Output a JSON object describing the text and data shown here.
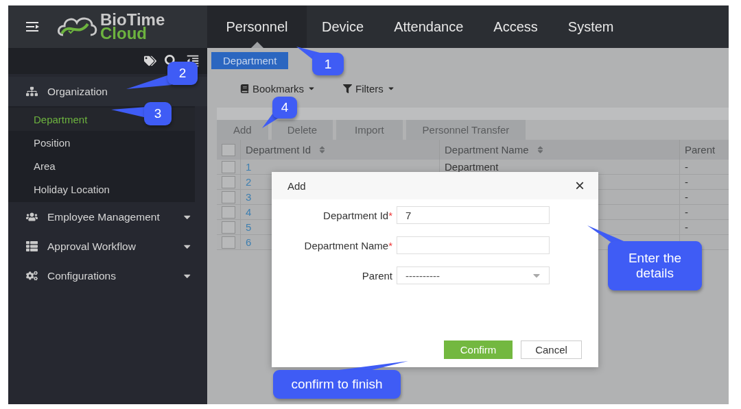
{
  "logo": {
    "line1": "BioTime",
    "line2": "Cloud"
  },
  "nav_tabs": [
    {
      "label": "Personnel",
      "selected": true
    },
    {
      "label": "Device",
      "selected": false
    },
    {
      "label": "Attendance",
      "selected": false
    },
    {
      "label": "Access",
      "selected": false
    },
    {
      "label": "System",
      "selected": false
    }
  ],
  "sidebar": {
    "items": [
      {
        "label": "Organization",
        "expanded": true,
        "children": [
          {
            "label": "Department",
            "selected": true
          },
          {
            "label": "Position",
            "selected": false
          },
          {
            "label": "Area",
            "selected": false
          },
          {
            "label": "Holiday Location",
            "selected": false
          }
        ]
      },
      {
        "label": "Employee Management",
        "expanded": false
      },
      {
        "label": "Approval Workflow",
        "expanded": false
      },
      {
        "label": "Configurations",
        "expanded": false
      }
    ]
  },
  "page_tab": "Department",
  "filters": [
    {
      "label": "Bookmarks"
    },
    {
      "label": "Filters"
    }
  ],
  "actions": [
    "Add",
    "Delete",
    "Import",
    "Personnel Transfer"
  ],
  "table": {
    "select_all_checked": false,
    "columns": [
      "Department Id",
      "Department Name",
      "Parent"
    ],
    "rows": [
      {
        "checked": false,
        "id": "1",
        "name": "Department",
        "parent": "-"
      },
      {
        "checked": false,
        "id": "2",
        "parent": "-"
      },
      {
        "checked": false,
        "id": "3",
        "parent": "-"
      },
      {
        "checked": false,
        "id": "4",
        "parent": "-"
      },
      {
        "checked": false,
        "id": "5",
        "parent": "-"
      },
      {
        "checked": false,
        "id": "6"
      }
    ]
  },
  "dialog": {
    "title": "Add",
    "close": "×",
    "fields": [
      {
        "kind": "text",
        "label": "Department Id",
        "required_mark": "*",
        "value": "7"
      },
      {
        "kind": "text",
        "label": "Department Name",
        "required_mark": "*"
      },
      {
        "kind": "select",
        "label": "Parent",
        "value": "----------"
      }
    ],
    "buttons": [
      {
        "label": "Confirm",
        "primary": true
      },
      {
        "label": "Cancel",
        "primary": false
      }
    ]
  },
  "callouts": [
    {
      "text": "1"
    },
    {
      "text": "2"
    },
    {
      "text": "3"
    },
    {
      "text": "4"
    },
    {
      "text": "Enter the details"
    },
    {
      "text": "confirm to finish"
    }
  ]
}
